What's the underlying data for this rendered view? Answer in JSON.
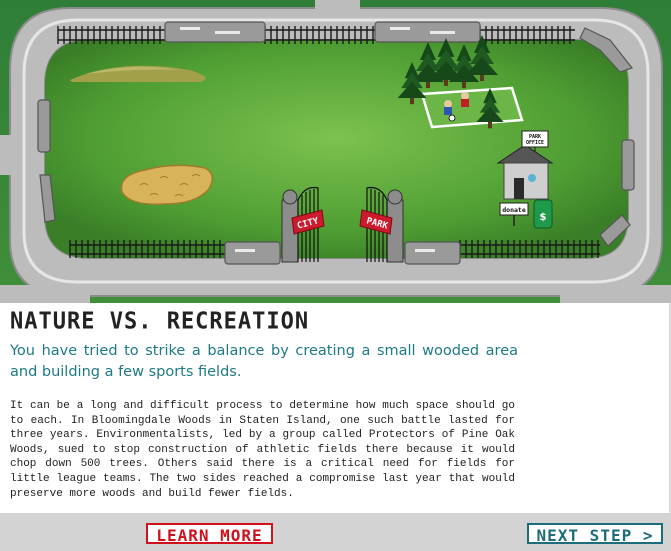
{
  "scene": {
    "gate_left_sign": "CITY",
    "gate_right_sign": "PARK",
    "office_sign": "PARK OFFICE",
    "donate_sign": "donate",
    "bin_symbol": "$"
  },
  "content": {
    "title": "NATURE VS. RECREATION",
    "subtitle": "You have tried to strike a balance by creating a small wooded area and building a few sports fields.",
    "body": "It can be a long and difficult process to determine how much space should go to each. In Bloomingdale Woods in Staten Island, one such battle lasted for three years. Environmentalists, led by a group called Protectors of Pine Oak Woods, sued to stop construction of athletic fields there because it would chop down 500 trees. Others said there is a critical need for fields for little league teams. The two sides reached a compromise last year that would preserve more woods and build fewer fields."
  },
  "footer": {
    "learn_more": "LEARN MORE",
    "next_step": "NEXT STEP >"
  },
  "colors": {
    "grass": "#4c9a33",
    "sky": "#2e7a3a",
    "path": "#b7b7b7",
    "title_text": "#222222",
    "subtitle_text": "#1d7a86",
    "learn_more": "#d0101a",
    "next_step": "#1b6c7c"
  }
}
